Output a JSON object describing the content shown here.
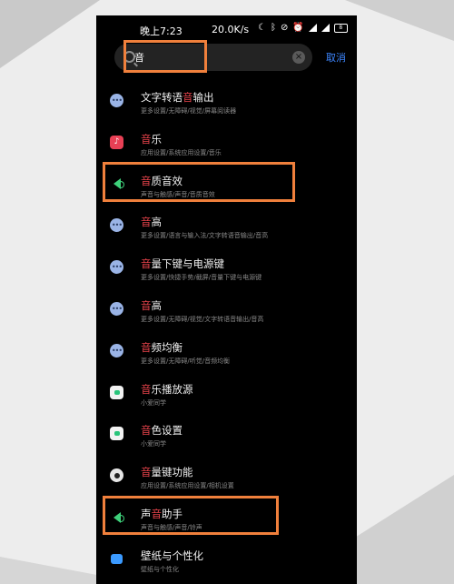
{
  "status_bar": {
    "time": "晚上7:23",
    "network_speed": "20.0K/s",
    "icons": [
      "moon-icon",
      "bluetooth-icon",
      "mute-icon",
      "alarm-icon",
      "signal-4g-icon",
      "signal-icon",
      "signal-4g-icon",
      "signal-icon",
      "battery-icon"
    ],
    "battery": "8"
  },
  "search": {
    "value": "音",
    "cancel_label": "取消"
  },
  "results": [
    {
      "pre": "文字转语",
      "hl": "音",
      "post": "输出",
      "sub": "更多设置/无障碍/视觉/屏幕阅读器",
      "icon": "more-icon"
    },
    {
      "pre": "",
      "hl": "音",
      "post": "乐",
      "sub": "应用设置/系统应用设置/音乐",
      "icon": "music-icon"
    },
    {
      "pre": "",
      "hl": "音",
      "post": "质音效",
      "sub": "声音与触感/声音/音质音效",
      "icon": "speaker-icon"
    },
    {
      "pre": "",
      "hl": "音",
      "post": "高",
      "sub": "更多设置/语言与输入法/文字转语音输出/音高",
      "icon": "more-icon"
    },
    {
      "pre": "",
      "hl": "音",
      "post": "量下键与电源键",
      "sub": "更多设置/快捷手势/截屏/音量下键与电源键",
      "icon": "more-icon"
    },
    {
      "pre": "",
      "hl": "音",
      "post": "高",
      "sub": "更多设置/无障碍/视觉/文字转语音输出/音高",
      "icon": "more-icon"
    },
    {
      "pre": "",
      "hl": "音",
      "post": "频均衡",
      "sub": "更多设置/无障碍/听觉/音频均衡",
      "icon": "more-icon"
    },
    {
      "pre": "",
      "hl": "音",
      "post": "乐播放源",
      "sub": "小爱同学",
      "icon": "xiaoai-icon"
    },
    {
      "pre": "",
      "hl": "音",
      "post": "色设置",
      "sub": "小爱同学",
      "icon": "xiaoai-icon"
    },
    {
      "pre": "",
      "hl": "音",
      "post": "量键功能",
      "sub": "应用设置/系统应用设置/相机设置",
      "icon": "camera-icon"
    },
    {
      "pre": "声",
      "hl": "音",
      "post": "助手",
      "sub": "声音与触感/声音/铃声",
      "icon": "speaker-icon"
    },
    {
      "pre": "壁纸与个性化",
      "hl": "",
      "post": "",
      "sub": "壁纸与个性化",
      "icon": "wallpaper-icon"
    }
  ],
  "colors": {
    "highlight_text": "#e8434b",
    "annotation_box": "#f0803c",
    "cancel_link": "#3d86ff"
  }
}
